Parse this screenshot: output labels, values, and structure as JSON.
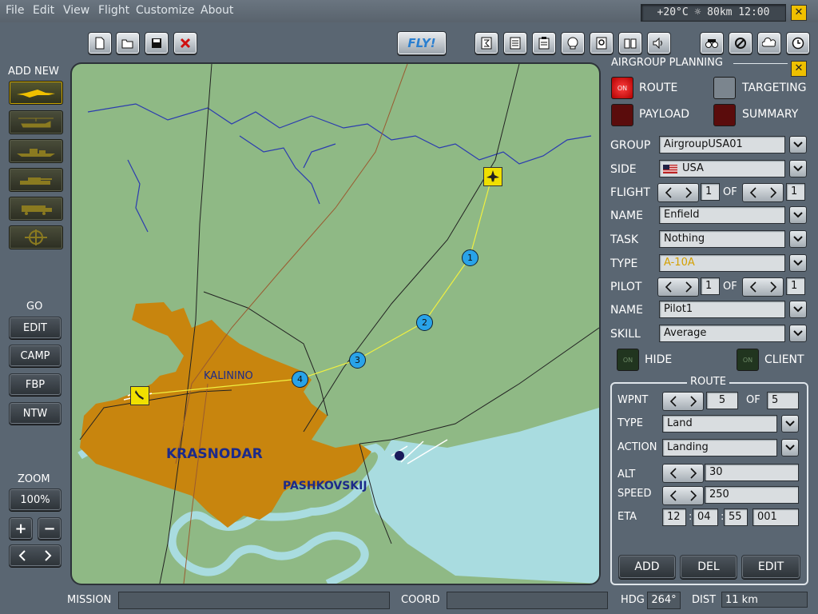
{
  "menu": [
    "File",
    "Edit",
    "View",
    "Flight",
    "Customize",
    "About"
  ],
  "status": "+20°C ☼ 80km 12:00",
  "toolbar": {
    "fly_label": "FLY!"
  },
  "left": {
    "add_new_label": "ADD NEW",
    "go_label": "GO",
    "go_buttons": [
      "EDIT",
      "CAMP",
      "FBP",
      "NTW"
    ],
    "zoom_label": "ZOOM",
    "zoom_value": "100%",
    "zoom_plus": "+",
    "zoom_minus": "−"
  },
  "map": {
    "cities": [
      "KALININO",
      "KRASNODAR",
      "PASHKOVSKIJ"
    ],
    "waypoints": [
      "1",
      "2",
      "3",
      "4"
    ]
  },
  "panel": {
    "title": "AIRGROUP PLANNING",
    "route_label": "ROUTE",
    "targeting_label": "TARGETING",
    "payload_label": "PAYLOAD",
    "summary_label": "SUMMARY",
    "on": "ON",
    "group_label": "GROUP",
    "group_value": "AirgroupUSA01",
    "side_label": "SIDE",
    "side_value": "USA",
    "flight_label": "FLIGHT",
    "flight_value": "1",
    "of_label": "OF",
    "flight_total": "1",
    "name_label": "NAME",
    "name_value": "Enfield",
    "task_label": "TASK",
    "task_value": "Nothing",
    "type_label": "TYPE",
    "type_value": "A-10A",
    "pilot_label": "PILOT",
    "pilot_value": "1",
    "pilot_total": "1",
    "pilot_name_label": "NAME",
    "pilot_name_value": "Pilot1",
    "skill_label": "SKILL",
    "skill_value": "Average",
    "hide_label": "HIDE",
    "client_label": "CLIENT"
  },
  "route": {
    "title": "ROUTE",
    "wpnt_label": "WPNT",
    "wpnt_value": "5",
    "of_label": "OF",
    "wpnt_total": "5",
    "type_label": "TYPE",
    "type_value": "Land",
    "action_label": "ACTION",
    "action_value": "Landing",
    "alt_label": "ALT",
    "alt_value": "30",
    "speed_label": "SPEED",
    "speed_value": "250",
    "eta_label": "ETA",
    "eta_h": "12",
    "eta_m": "04",
    "eta_s": "55",
    "eta_d": "001",
    "add_label": "ADD",
    "del_label": "DEL",
    "edit_label": "EDIT"
  },
  "bottom": {
    "mission_label": "MISSION",
    "coord_label": "COORD",
    "hdg_label": "HDG",
    "hdg_value": "264°",
    "dist_label": "DIST",
    "dist_value": "11 km"
  },
  "colors": {
    "land": "#8fb985",
    "water": "#a9dce0",
    "city": "#c8850e",
    "route": "#f0f040",
    "waypoint": "#29a3e8",
    "river": "#2b3bb0",
    "accent": "#f0c000"
  }
}
